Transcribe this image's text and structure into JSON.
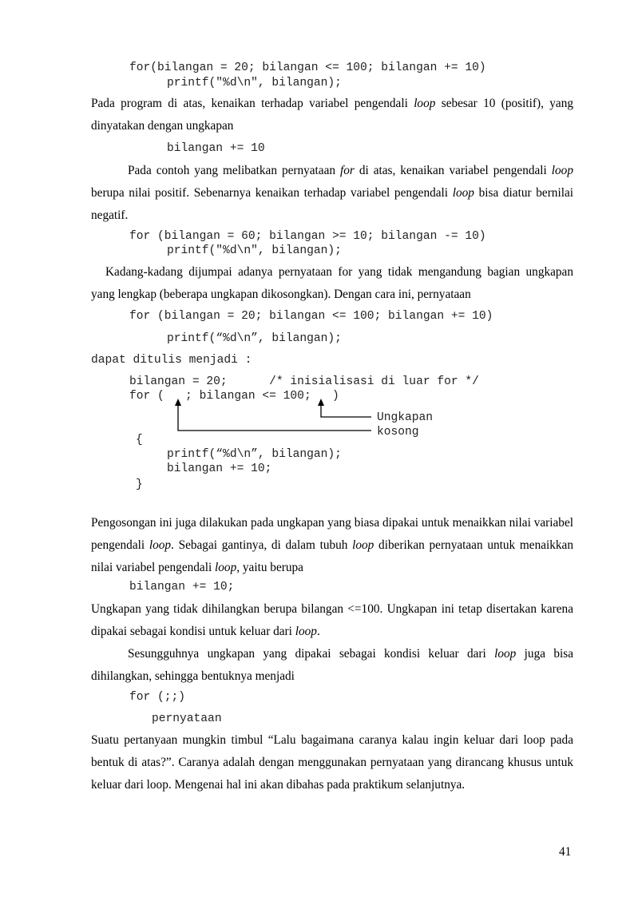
{
  "code_block_1": {
    "line1": "for(bilangan = 20; bilangan <= 100; bilangan += 10)",
    "line2": "printf(\"%d\\n\", bilangan);"
  },
  "para1": {
    "a": "Pada program di atas, kenaikan terhadap variabel pengendali ",
    "loop": "loop",
    "b": " sebesar 10 (positif), yang dinyatakan dengan ungkapan"
  },
  "code_inc": "bilangan += 10",
  "para2": {
    "a": "Pada contoh yang melibatkan pernyataan ",
    "for": "for",
    "b": " di atas, kenaikan variabel pengendali ",
    "loop1": "loop",
    "c": " berupa nilai positif. Sebenarnya kenaikan terhadap variabel pengendali ",
    "loop2": "loop",
    "d": " bisa diatur bernilai negatif."
  },
  "code_block_2": {
    "line1": "for (bilangan = 60; bilangan >= 10; bilangan -= 10)",
    "line2": "printf(\"%d\\n\", bilangan);"
  },
  "para3": "Kadang-kadang dijumpai adanya pernyataan for yang tidak mengandung bagian ungkapan yang lengkap (beberapa ungkapan dikosongkan). Dengan cara ini, pernyataan",
  "code_block_3": {
    "line1": "for (bilangan = 20; bilangan <= 100; bilangan += 10)",
    "line2": "printf(“%d\\n”, bilangan);"
  },
  "code_written": "dapat ditulis menjadi :",
  "code_block_4": {
    "line1": "bilangan = 20;      /* inisialisasi di luar for */",
    "line2": "for (   ; bilangan <= 100;   )",
    "brace_open": "{",
    "line3": "printf(“%d\\n”, bilangan);",
    "line4": "bilangan += 10;",
    "brace_close": "}"
  },
  "annotation": {
    "line1": "Ungkapan",
    "line2": "kosong"
  },
  "para4": {
    "a": "Pengosongan ini juga dilakukan pada ungkapan yang biasa dipakai untuk menaikkan nilai variabel pengendali ",
    "loop1": "loop",
    "b": ". Sebagai gantinya, di dalam tubuh ",
    "loop2": "loop",
    "c": " diberikan pernyataan untuk menaikkan nilai variabel pengendali ",
    "loop3": "loop",
    "d": ", yaitu berupa"
  },
  "code_inc2": "bilangan += 10;",
  "para5": {
    "a": "Ungkapan yang tidak dihilangkan berupa bilangan <=100. Ungkapan ini tetap disertakan karena dipakai sebagai kondisi untuk keluar dari ",
    "loop": "loop",
    "b": "."
  },
  "para6": {
    "a": "Sesungguhnya ungkapan yang dipakai sebagai kondisi keluar dari ",
    "loop": "loop",
    "b": " juga bisa dihilangkan, sehingga bentuknya menjadi"
  },
  "code_block_5": {
    "line1": "for (;;)",
    "line2": "pernyataan"
  },
  "para7": "Suatu pertanyaan mungkin timbul “Lalu bagaimana caranya kalau ingin keluar dari loop pada bentuk di atas?”. Caranya adalah dengan menggunakan pernyataan yang dirancang khusus untuk keluar dari loop. Mengenai hal ini akan dibahas pada praktikum selanjutnya.",
  "page_number": "41"
}
